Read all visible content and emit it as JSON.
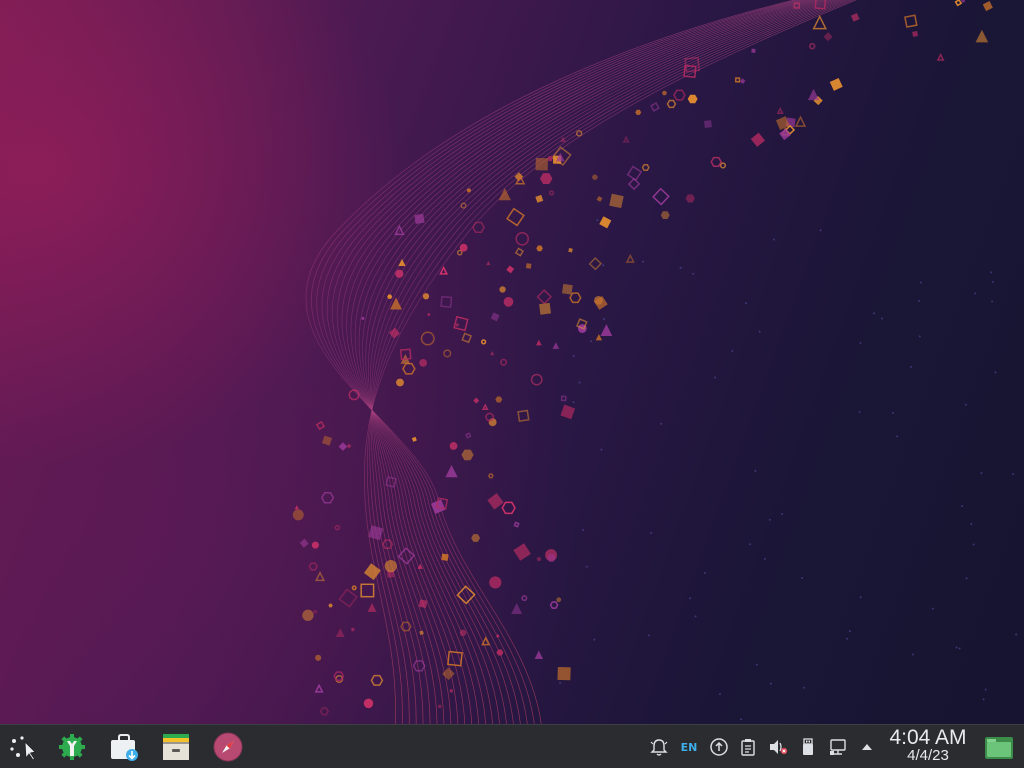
{
  "desktop": {
    "wallpaper_icon": "abstract-wave-particles"
  },
  "taskbar": {
    "launchers": [
      {
        "name": "app-launcher",
        "icon": "app-launcher-icon"
      },
      {
        "name": "system-settings",
        "icon": "settings-wrench-gear-icon"
      },
      {
        "name": "discover-store",
        "icon": "shopping-bag-download-icon"
      },
      {
        "name": "file-archiver",
        "icon": "archive-box-icon"
      },
      {
        "name": "web-browser",
        "icon": "compass-icon"
      }
    ],
    "tray": {
      "language": "EN",
      "icons": [
        "notifications-bell-icon",
        "language-indicator",
        "updates-icon",
        "clipboard-icon",
        "volume-muted-icon",
        "usb-device-icon",
        "network-wired-icon",
        "expand-arrow-icon"
      ]
    },
    "clock": {
      "time": "4:04 AM",
      "date": "4/4/23"
    },
    "show_desktop_icon": "show-desktop-icon"
  },
  "colors": {
    "taskbar_bg": "#2a2c30",
    "accent": "#3daee9",
    "settings_green": "#2eaa4f"
  }
}
